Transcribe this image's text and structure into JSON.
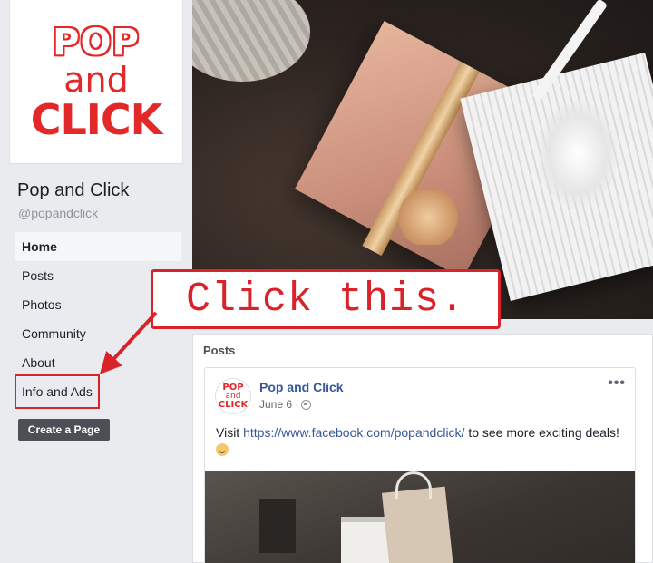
{
  "sidebar": {
    "logo": {
      "line1": "POP",
      "line2": "and",
      "line3": "CLICK"
    },
    "page_name": "Pop and Click",
    "page_handle": "@popandclick",
    "nav": [
      {
        "label": "Home",
        "active": true
      },
      {
        "label": "Posts"
      },
      {
        "label": "Photos"
      },
      {
        "label": "Community"
      },
      {
        "label": "About"
      },
      {
        "label": "Info and Ads"
      }
    ],
    "create_page_label": "Create a Page"
  },
  "feed": {
    "section_title": "Posts",
    "post": {
      "author": "Pop and Click",
      "date": "June 6 ·",
      "more_label": "•••",
      "text_before": "Visit ",
      "link": "https://www.facebook.com/popandclick/",
      "text_after": " to see more exciting deals!",
      "avatar": {
        "line1": "POP",
        "line2": "and",
        "line3": "CLICK"
      }
    }
  },
  "annotation": {
    "callout_text": "Click this.",
    "color": "#d8232a"
  },
  "colors": {
    "link": "#385898",
    "page_bg": "#e9ebee",
    "button": "#4b4f56"
  }
}
